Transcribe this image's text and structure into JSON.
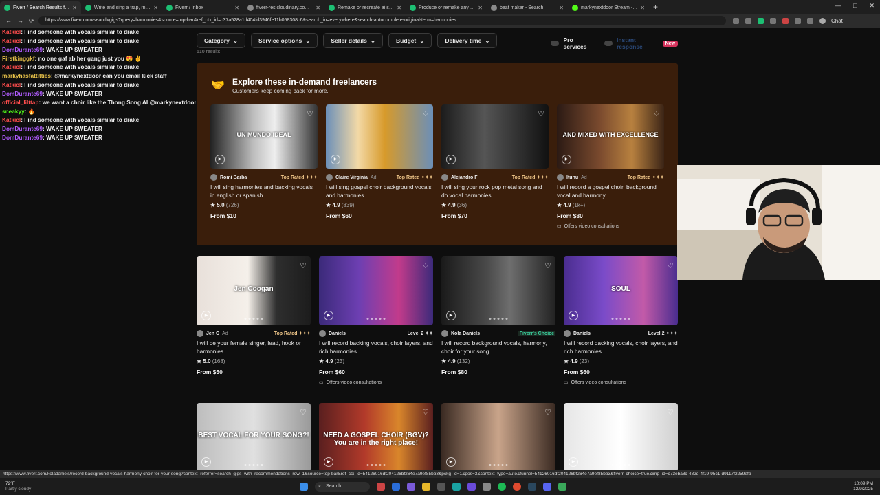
{
  "browser": {
    "tabs": [
      {
        "title": "Fiverr / Search Results for 'ha",
        "color": "#1dbf73",
        "active": true
      },
      {
        "title": "Write and sing a trap, rnb, reggae",
        "color": "#1dbf73",
        "active": false
      },
      {
        "title": "Fiverr / Inbox",
        "color": "#1dbf73",
        "active": false
      },
      {
        "title": "fiverr-res.cloudinary.com/video/u",
        "color": "#8a8a8a",
        "active": false
      },
      {
        "title": "Remake or recreate ai song to hig",
        "color": "#1dbf73",
        "active": false
      },
      {
        "title": "Produce or remake any beats and",
        "color": "#1dbf73",
        "active": false
      },
      {
        "title": "beat maker - Search",
        "color": "#8a8a8a",
        "active": false
      },
      {
        "title": "markynextdoor Stream - Watch Li",
        "color": "#53fc18",
        "active": false
      }
    ],
    "url": "https://www.fiverr.com/search/gigs?query=harmonies&source=top-bar&ref_ctx_id=c37a528a1d404fd3946fe11b058308c6&search_in=everywhere&search-autocomplete-original-term=harmonies",
    "chat_label": "Chat",
    "status_url": "https://www.fiverr.com/koladaniels/record-background-vocals-harmony-choir-for-your-song?context_referrer=search_gigs_with_recommendations_row_1&source=top-bar&ref_ctx_id=54126016df204126bf264e7a9ef85bb3&pckg_id=1&pos=3&context_type=auto&funnel=54126016df204126bf264e7a9ef85bb3&fiverr_choice=true&imp_id=c73eba8c-482d-4f19-95c1-d9117f2259efb"
  },
  "chat": [
    {
      "user": "Katkicl",
      "color": "#ff4d4d",
      "msg": "Find someone with vocals similar to drake"
    },
    {
      "user": "Katkicl",
      "color": "#ff4d4d",
      "msg": "Find someone with vocals similar to drake"
    },
    {
      "user": "DomDurante69",
      "color": "#b05cff",
      "msg": "WAKE UP SWEATER"
    },
    {
      "user": "Firstkinggkf",
      "color": "#e8c24a",
      "msg": "no one gaf ab her gang just you 😍 ✌"
    },
    {
      "user": "Katkicl",
      "color": "#ff4d4d",
      "msg": "Find someone with vocals similar to drake"
    },
    {
      "user": "markyhasfattitties",
      "color": "#e8c24a",
      "msg": "@markynextdoor can you email kick staff"
    },
    {
      "user": "Katkicl",
      "color": "#ff4d4d",
      "msg": "Find someone with vocals similar to drake"
    },
    {
      "user": "DomDurante69",
      "color": "#b05cff",
      "msg": "WAKE UP SWEATER"
    },
    {
      "user": "official_lilttap",
      "color": "#ff4d4d",
      "msg": "we want a choir like the Thong Song AI @markynextdoor"
    },
    {
      "user": "sneakyy",
      "color": "#53fc18",
      "msg": "🔥"
    },
    {
      "user": "Katkicl",
      "color": "#ff4d4d",
      "msg": "Find someone with vocals similar to drake"
    },
    {
      "user": "DomDurante69",
      "color": "#b05cff",
      "msg": "WAKE UP SWEATER"
    },
    {
      "user": "DomDurante69",
      "color": "#b05cff",
      "msg": "WAKE UP SWEATER"
    }
  ],
  "filters": [
    "Category",
    "Service options",
    "Seller details",
    "Budget",
    "Delivery time"
  ],
  "toggles": {
    "pro": "Pro services",
    "instant": "Instant response",
    "new_badge": "New"
  },
  "results_count": "510 results",
  "featured": {
    "title": "Explore these in-demand freelancers",
    "subtitle": "Customers keep coming back for more.",
    "cards": [
      {
        "name": "Romi Barba",
        "ad": "",
        "badge": "Top Rated ✦✦✦",
        "title": "I will sing harmonies and backing vocals in english or spanish",
        "rating": "5.0",
        "count": "(726)",
        "price": "From $10",
        "consult": "",
        "thumb_text": "UN MUNDO IDEAL",
        "bg": "linear-gradient(90deg,#222 0%,#bdbdbd 40%,#eee 60%,#333 100%)"
      },
      {
        "name": "Claire Virginia",
        "ad": "Ad",
        "badge": "Top Rated ✦✦✦",
        "title": "I will sing gospel choir background vocals and harmonies",
        "rating": "4.9",
        "count": "(839)",
        "price": "From $60",
        "consult": "",
        "thumb_text": "",
        "bg": "linear-gradient(90deg,#6b8fb8 0%,#f3d9a6 30%,#d79a2b 55%,#6b8fb8 100%)"
      },
      {
        "name": "Alejandro F",
        "ad": "",
        "badge": "Top Rated ✦✦✦",
        "title": "I will sing your rock pop metal song and do vocal harmonies",
        "rating": "4.9",
        "count": "(36)",
        "price": "From $70",
        "consult": "",
        "thumb_text": "",
        "bg": "linear-gradient(90deg,#1c1c1c 0%,#555 40%,#333 70%,#111 100%)"
      },
      {
        "name": "Itunu",
        "ad": "Ad",
        "badge": "Top Rated ✦✦✦",
        "title": "I will record a gospel choir, background vocal and harmony",
        "rating": "4.9",
        "count": "(1k+)",
        "price": "From $80",
        "consult": "Offers video consultations",
        "thumb_text": "AND MIXED WITH EXCELLENCE",
        "bg": "linear-gradient(90deg,#2b1a14 0%,#7a4a2e 40%,#b8813f 70%,#3b2416 100%)"
      }
    ]
  },
  "gigs": [
    {
      "name": "Jen C",
      "ad": "Ad",
      "badge": "Top Rated ✦✦✦",
      "badge_type": "top",
      "title": "I will be your female singer, lead, hook or harmonies",
      "rating": "5.0",
      "count": "(168)",
      "price": "From $50",
      "consult": "",
      "thumb_text": "Jen Coogan",
      "bg": "linear-gradient(90deg,#e8e0da 0%,#f5f0ea 45%,#2e2e2e 70%,#1c1c1c 100%)"
    },
    {
      "name": "Daniels",
      "ad": "",
      "badge": "Level 2 ✦✦",
      "badge_type": "lvl",
      "title": "I will record backing vocals, choir layers, and rich harmonies",
      "rating": "4.9",
      "count": "(23)",
      "price": "From $60",
      "consult": "Offers video consultations",
      "thumb_text": "",
      "bg": "linear-gradient(90deg,#3b2a7a 0%,#6d3fb2 35%,#c23b8b 70%,#3b2a7a 100%)"
    },
    {
      "name": "Kola Daniels",
      "ad": "",
      "badge": "Fiverr's Choice",
      "badge_type": "choice",
      "title": "I will record background vocals, harmony, choir for your song",
      "rating": "4.9",
      "count": "(132)",
      "price": "From $80",
      "consult": "",
      "thumb_text": "",
      "bg": "linear-gradient(90deg,#1a1a1a 0%,#4a4a4a 40%,#6e6e6e 60%,#222 100%)"
    },
    {
      "name": "Daniels",
      "ad": "",
      "badge": "Level 2 ✦✦✦",
      "badge_type": "lvl",
      "title": "I will record backing vocals, choir layers, and rich harmonies",
      "rating": "4.9",
      "count": "(23)",
      "price": "From $60",
      "consult": "Offers video consultations",
      "thumb_text": "SOUL",
      "bg": "linear-gradient(90deg,#4a2d8f 0%,#7a4bc9 35%,#c25aa8 70%,#4a2d8f 100%)"
    }
  ],
  "gigs_row2": [
    {
      "thumb_text": "BEST VOCAL FOR YOUR SONG?!",
      "bg": "linear-gradient(90deg,#bdbdbd 0%,#e0e0e0 50%,#9a9a9a 100%)"
    },
    {
      "thumb_text": "NEED A GOSPEL CHOIR (BGV)? You are in the right place!",
      "bg": "linear-gradient(90deg,#5a1f1f 0%,#b23a2a 40%,#d9862b 70%,#5a1f1f 100%)"
    },
    {
      "thumb_text": "",
      "bg": "linear-gradient(90deg,#3a2a22 0%,#c9a48a 50%,#3a2a22 100%)"
    },
    {
      "thumb_text": "",
      "bg": "linear-gradient(90deg,#e6e6e6 0%,#ffffff 50%,#d0d0d0 100%)"
    }
  ],
  "taskbar": {
    "weather_temp": "72°F",
    "weather_desc": "Partly cloudy",
    "search": "Search",
    "time": "10:09 PM",
    "date": "12/9/2025"
  }
}
